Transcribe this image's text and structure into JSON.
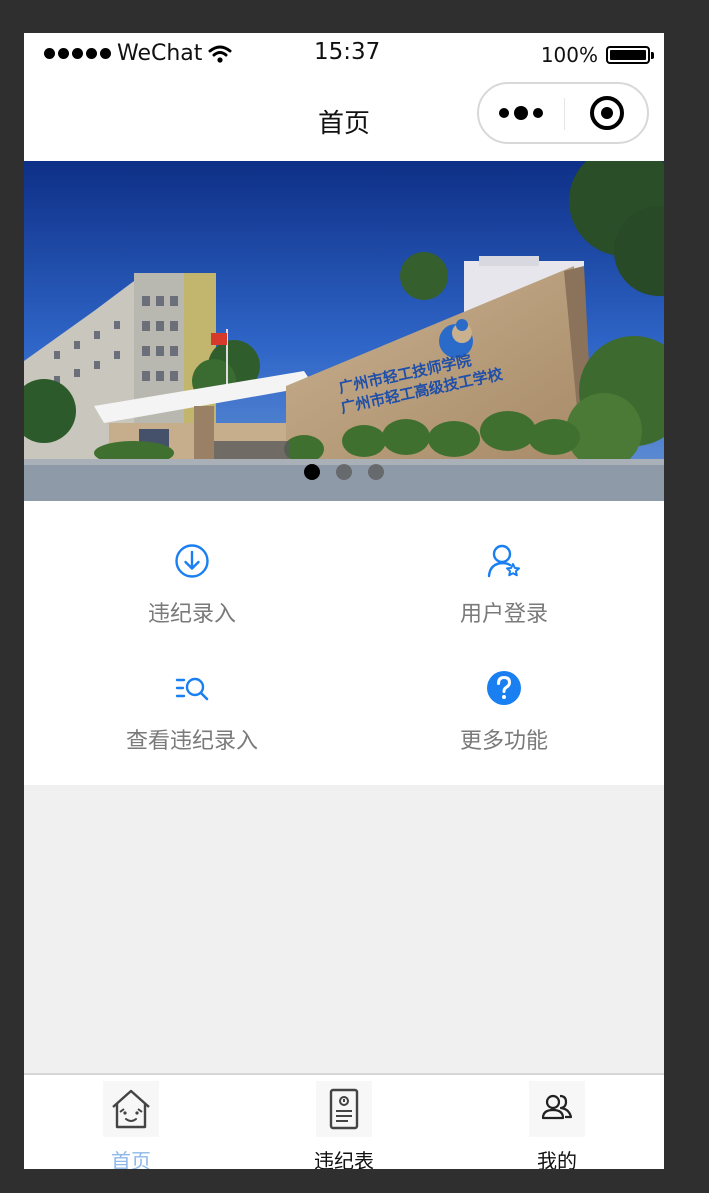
{
  "status_bar": {
    "carrier": "WeChat",
    "time": "15:37",
    "battery": "100%"
  },
  "nav": {
    "title": "首页"
  },
  "banner": {
    "school_name_line1": "广州市轻工技师学院",
    "school_name_line2": "广州市轻工高级技工学校",
    "slide_count": 3,
    "active_slide": 1
  },
  "grid": [
    {
      "label": "违纪录入",
      "icon": "download-circle-icon"
    },
    {
      "label": "用户登录",
      "icon": "user-star-icon"
    },
    {
      "label": "查看违纪录入",
      "icon": "list-search-icon"
    },
    {
      "label": "更多功能",
      "icon": "help-circle-icon"
    }
  ],
  "tabbar": [
    {
      "label": "首页",
      "icon": "home-icon",
      "active": true
    },
    {
      "label": "违纪表",
      "icon": "document-icon",
      "active": false
    },
    {
      "label": "我的",
      "icon": "users-icon",
      "active": false
    }
  ],
  "colors": {
    "accent": "#1a7ff0",
    "tab_active": "#8eb8ec",
    "label_gray": "#7a7a7a",
    "page_bg": "#f0f0f0"
  }
}
